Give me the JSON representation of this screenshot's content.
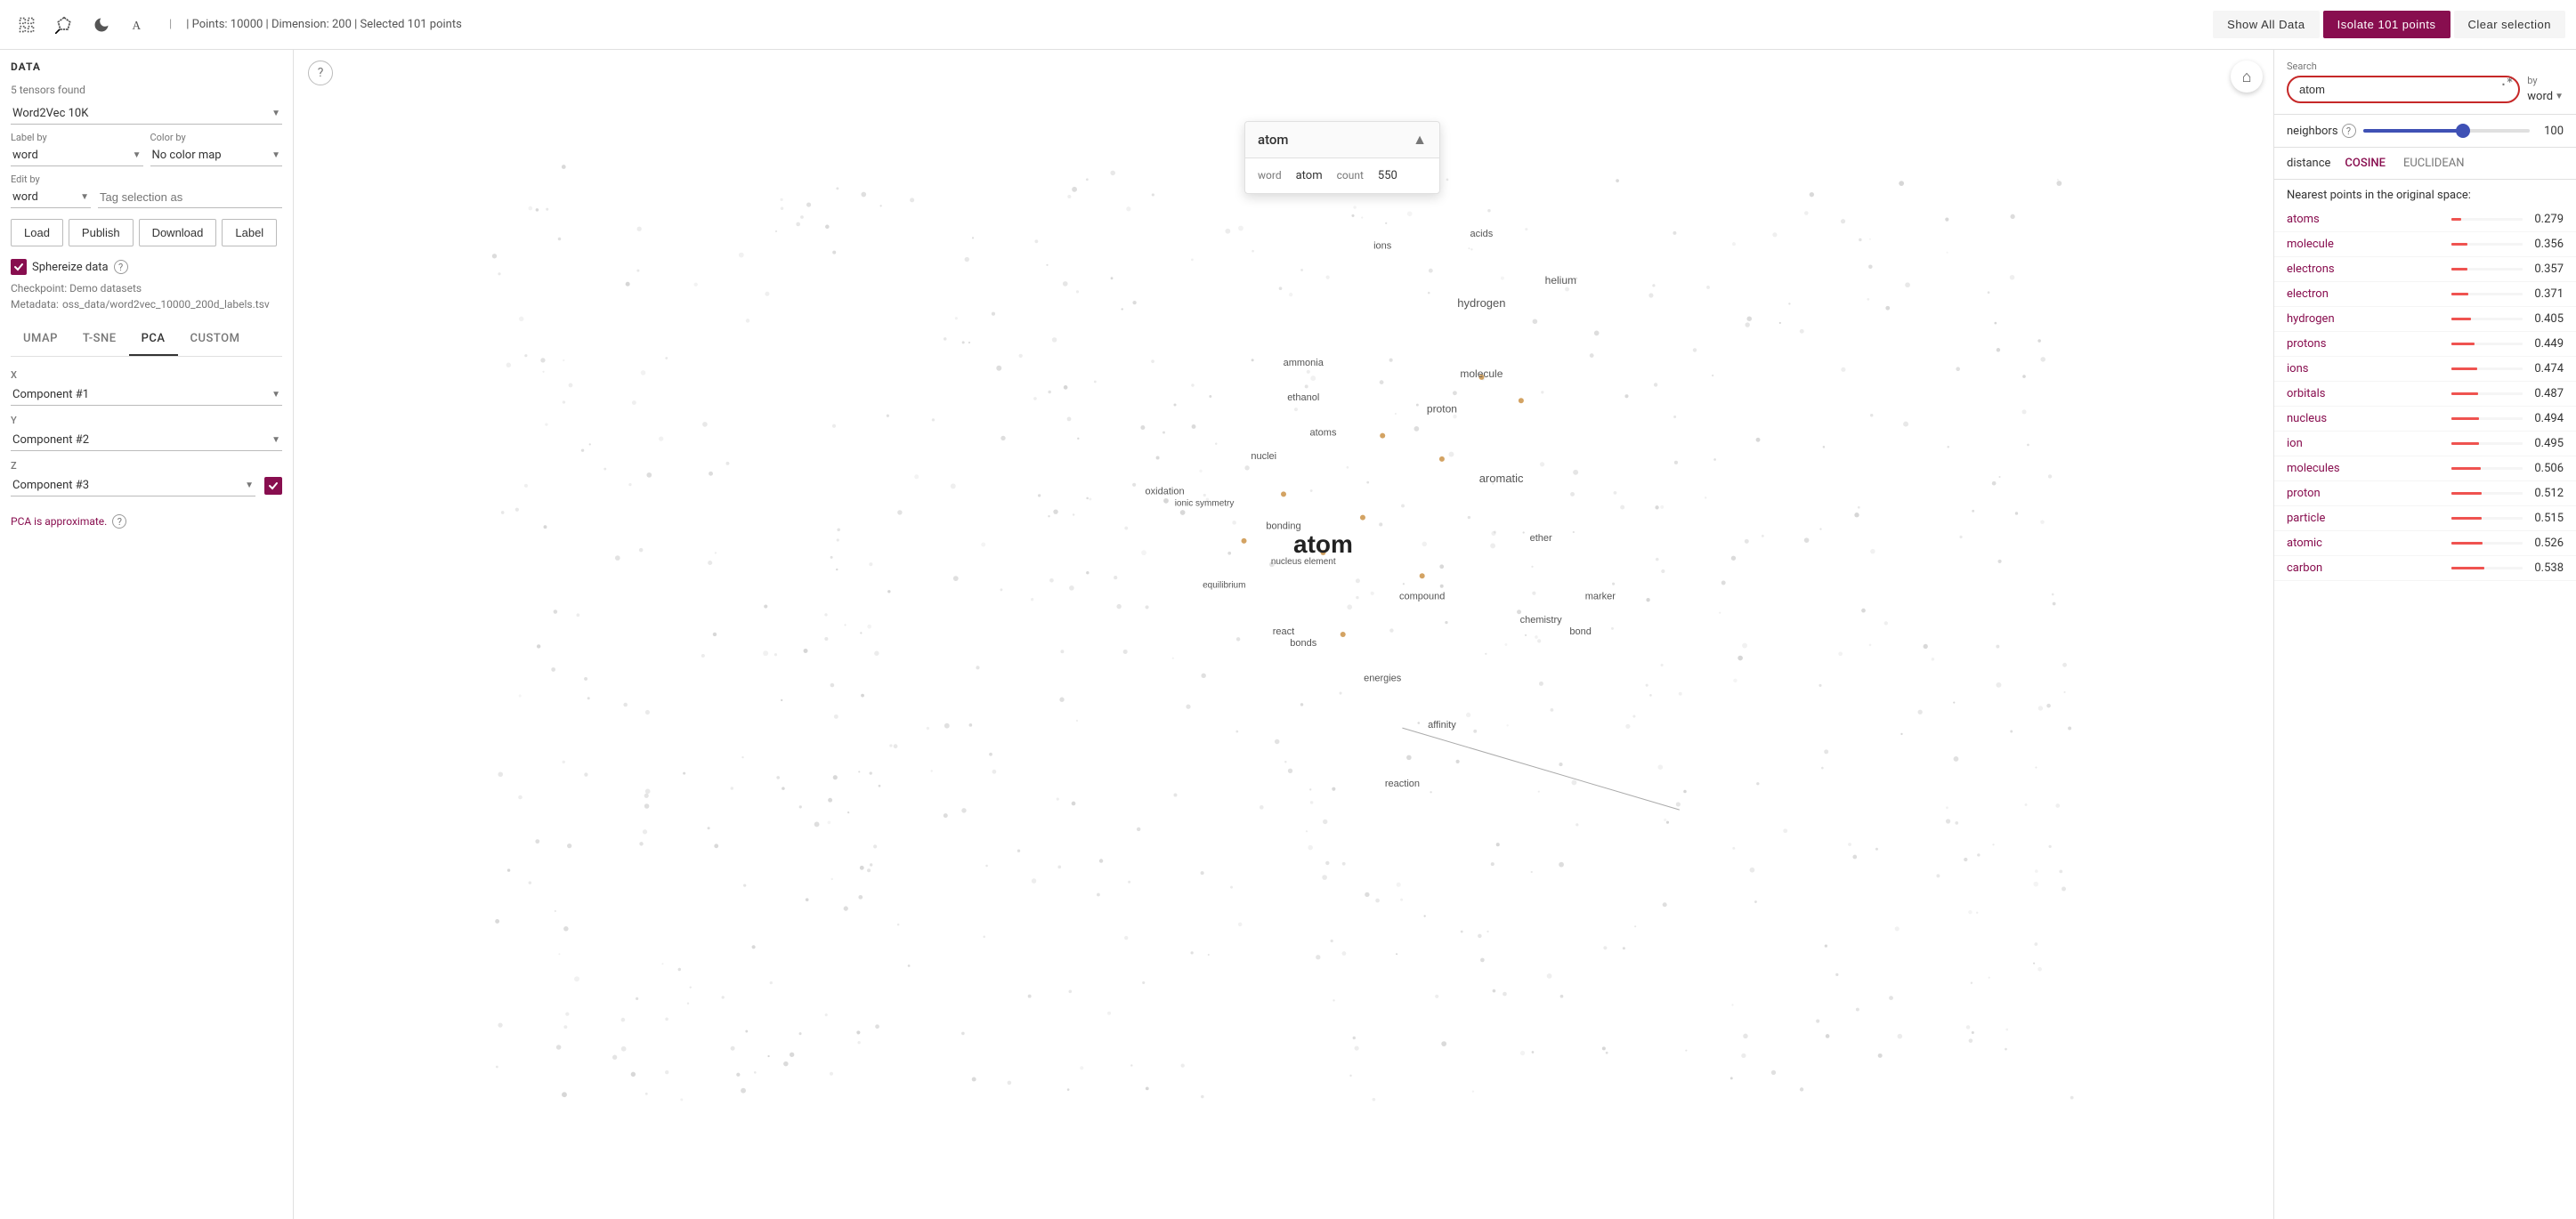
{
  "topbar": {
    "points_info": "| Points: 10000 | Dimension: 200 | Selected 101 points",
    "show_all_label": "Show All Data",
    "isolate_label": "Isolate 101 points",
    "clear_label": "Clear selection"
  },
  "sidebar": {
    "title": "DATA",
    "tensors_found": "5 tensors found",
    "tensor_selected": "Word2Vec 10K",
    "label_by_label": "Label by",
    "label_by_value": "word",
    "color_by_label": "Color by",
    "color_by_value": "No color map",
    "edit_by_label": "Edit by",
    "edit_by_value": "word",
    "tag_placeholder": "Tag selection as",
    "btn_load": "Load",
    "btn_publish": "Publish",
    "btn_download": "Download",
    "btn_label": "Label",
    "sphereize_label": "Sphereize data",
    "checkpoint_label": "Checkpoint:",
    "checkpoint_value": "Demo datasets",
    "metadata_label": "Metadata:",
    "metadata_value": "oss_data/word2vec_10000_200d_labels.tsv",
    "proj_tabs": [
      "UMAP",
      "T-SNE",
      "PCA",
      "CUSTOM"
    ],
    "active_tab": "PCA",
    "x_label": "X",
    "x_value": "Component #1",
    "y_label": "Y",
    "y_value": "Component #2",
    "z_label": "Z",
    "z_value": "Component #3",
    "pca_note": "PCA is approximate."
  },
  "atom_popup": {
    "title": "atom",
    "word_label": "word",
    "word_value": "atom",
    "count_label": "count",
    "count_value": "550"
  },
  "right_panel": {
    "search_label": "Search",
    "search_value": "atom",
    "search_placeholder": "atom",
    "regex_symbol": ".*",
    "by_label": "by",
    "by_value": "word",
    "neighbors_label": "neighbors",
    "neighbors_value": "100",
    "slider_pct": 60,
    "distance_label": "distance",
    "dist_cosine": "COSINE",
    "dist_euclidean": "EUCLIDEAN",
    "nearest_header": "Nearest points in the original space:",
    "nearest_points": [
      {
        "word": "atoms",
        "value": "0.279",
        "bar_pct": 14
      },
      {
        "word": "molecule",
        "value": "0.356",
        "bar_pct": 22
      },
      {
        "word": "electrons",
        "value": "0.357",
        "bar_pct": 22
      },
      {
        "word": "electron",
        "value": "0.371",
        "bar_pct": 24
      },
      {
        "word": "hydrogen",
        "value": "0.405",
        "bar_pct": 28
      },
      {
        "word": "protons",
        "value": "0.449",
        "bar_pct": 33
      },
      {
        "word": "ions",
        "value": "0.474",
        "bar_pct": 36
      },
      {
        "word": "orbitals",
        "value": "0.487",
        "bar_pct": 38
      },
      {
        "word": "nucleus",
        "value": "0.494",
        "bar_pct": 39
      },
      {
        "word": "ion",
        "value": "0.495",
        "bar_pct": 39
      },
      {
        "word": "molecules",
        "value": "0.506",
        "bar_pct": 41
      },
      {
        "word": "proton",
        "value": "0.512",
        "bar_pct": 42
      },
      {
        "word": "particle",
        "value": "0.515",
        "bar_pct": 43
      },
      {
        "word": "atomic",
        "value": "0.526",
        "bar_pct": 44
      },
      {
        "word": "carbon",
        "value": "0.538",
        "bar_pct": 46
      }
    ]
  },
  "scatter": {
    "words": [
      {
        "text": "atom",
        "x": 52,
        "y": 43,
        "size": 28,
        "weight": "bold"
      },
      {
        "text": "aromatic",
        "x": 61,
        "y": 37,
        "size": 13
      },
      {
        "text": "nuclei",
        "x": 49,
        "y": 35,
        "size": 11
      },
      {
        "text": "ionic symmetry",
        "x": 46,
        "y": 39,
        "size": 10
      },
      {
        "text": "bonding",
        "x": 50,
        "y": 41,
        "size": 11
      },
      {
        "text": "nucleus element",
        "x": 51,
        "y": 44,
        "size": 10
      },
      {
        "text": "ether",
        "x": 63,
        "y": 42,
        "size": 11
      },
      {
        "text": "marker",
        "x": 66,
        "y": 47,
        "size": 11
      },
      {
        "text": "compound",
        "x": 57,
        "y": 47,
        "size": 11
      },
      {
        "text": "chemistry",
        "x": 63,
        "y": 49,
        "size": 11
      },
      {
        "text": "bond",
        "x": 65,
        "y": 50,
        "size": 11
      },
      {
        "text": "react",
        "x": 50,
        "y": 50,
        "size": 11
      },
      {
        "text": "bonds",
        "x": 51,
        "y": 51,
        "size": 11
      },
      {
        "text": "energies",
        "x": 55,
        "y": 54,
        "size": 11
      },
      {
        "text": "affinity",
        "x": 58,
        "y": 58,
        "size": 11
      },
      {
        "text": "reaction",
        "x": 56,
        "y": 63,
        "size": 11
      },
      {
        "text": "proton",
        "x": 58,
        "y": 31,
        "size": 12
      },
      {
        "text": "molecule",
        "x": 60,
        "y": 28,
        "size": 12
      },
      {
        "text": "hydrogen",
        "x": 60,
        "y": 22,
        "size": 13
      },
      {
        "text": "helium",
        "x": 64,
        "y": 20,
        "size": 12
      },
      {
        "text": "ammonia",
        "x": 51,
        "y": 27,
        "size": 11
      },
      {
        "text": "ethanol",
        "x": 51,
        "y": 30,
        "size": 11
      },
      {
        "text": "atoms",
        "x": 52,
        "y": 33,
        "size": 11
      },
      {
        "text": "equilibrium",
        "x": 47,
        "y": 46,
        "size": 10
      },
      {
        "text": "oxidation",
        "x": 44,
        "y": 38,
        "size": 11
      },
      {
        "text": "ions",
        "x": 55,
        "y": 17,
        "size": 11
      },
      {
        "text": "acids",
        "x": 60,
        "y": 16,
        "size": 11
      }
    ]
  }
}
